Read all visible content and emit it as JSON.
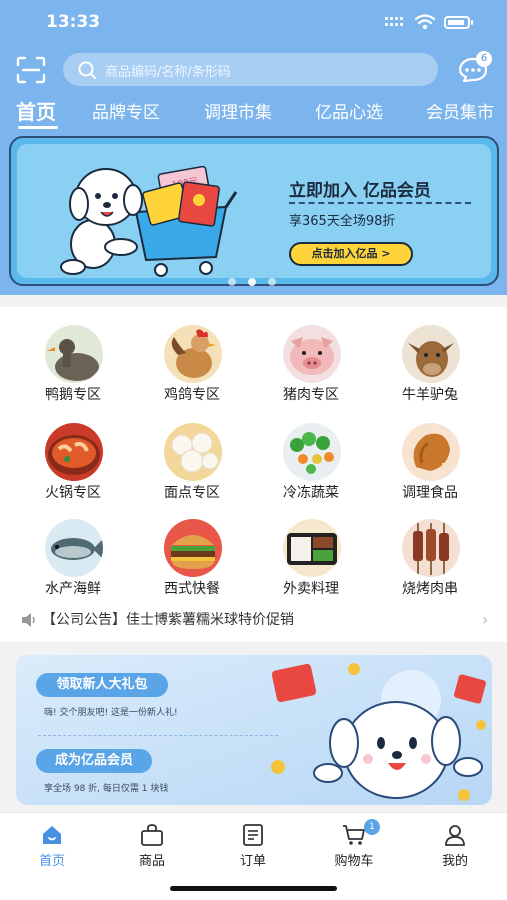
{
  "status_bar": {
    "time": "13:33"
  },
  "header": {
    "search_placeholder": "商品编码/名称/条形码",
    "message_badge": "6",
    "tabs": [
      "首页",
      "品牌专区",
      "调理市集",
      "亿品心选",
      "会员集市"
    ]
  },
  "banner": {
    "title": "立即加入 亿品会员",
    "subtitle": "享365天全场98折",
    "button": "点击加入亿品 >",
    "ticket_text": "100元"
  },
  "categories": [
    {
      "label": "鸭鹅专区",
      "icon": "goose-icon"
    },
    {
      "label": "鸡鸽专区",
      "icon": "rooster-icon"
    },
    {
      "label": "猪肉专区",
      "icon": "pig-icon"
    },
    {
      "label": "牛羊驴兔",
      "icon": "cow-icon"
    },
    {
      "label": "火锅专区",
      "icon": "hotpot-icon"
    },
    {
      "label": "面点专区",
      "icon": "bun-icon"
    },
    {
      "label": "冷冻蔬菜",
      "icon": "vegetable-icon"
    },
    {
      "label": "调理食品",
      "icon": "fried-chicken-icon"
    },
    {
      "label": "水产海鲜",
      "icon": "fish-icon"
    },
    {
      "label": "西式快餐",
      "icon": "burger-icon"
    },
    {
      "label": "外卖料理",
      "icon": "bento-icon"
    },
    {
      "label": "烧烤肉串",
      "icon": "skewer-icon"
    }
  ],
  "notice": {
    "text": "【公司公告】佳士博紫薯糯米球特价促销"
  },
  "promo": {
    "gift_button": "领取新人大礼包",
    "gift_desc": "嗨! 交个朋友吧! 这是一份新人礼!",
    "member_button": "成为亿品会员",
    "member_desc": "享全场 98 折, 每日仅需 1 块钱"
  },
  "nav": {
    "items": [
      "首页",
      "商品",
      "订单",
      "购物车",
      "我的"
    ],
    "cart_badge": "1"
  },
  "colors": {
    "header_blue": "#7cb4ee",
    "accent": "#4a90e2",
    "badge": "#5aa4e8"
  }
}
